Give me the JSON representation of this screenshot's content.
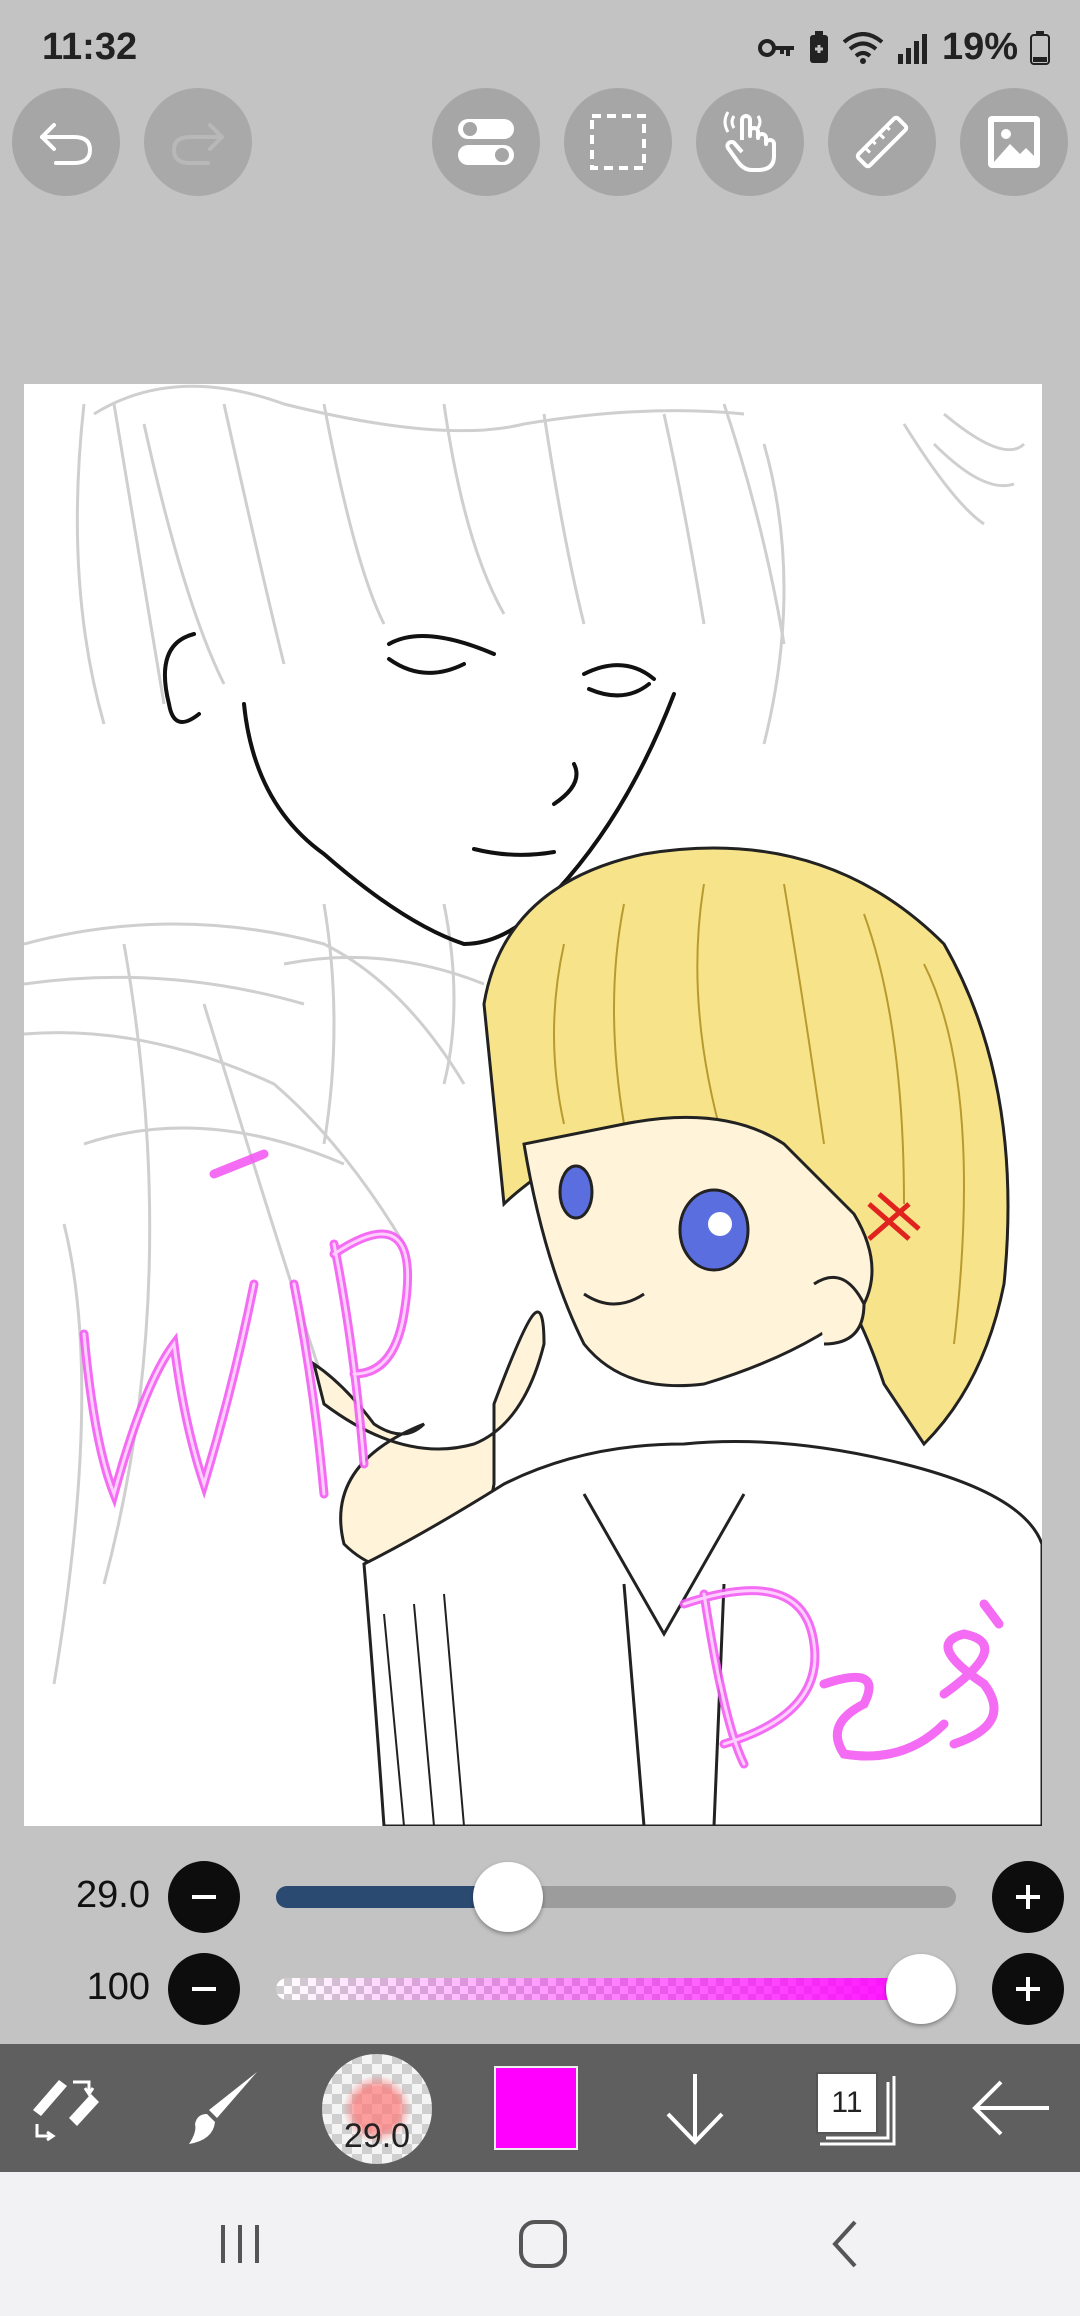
{
  "status": {
    "time": "11:32",
    "battery": "19%",
    "icons": [
      "vpn-key-icon",
      "battery-saver-icon",
      "wifi-icon",
      "signal-icon",
      "battery-icon"
    ]
  },
  "toolbar_top": {
    "icons": [
      "undo-icon",
      "redo-icon",
      "toggle-icon",
      "selection-icon",
      "hand-tool-icon",
      "ruler-icon",
      "image-icon"
    ]
  },
  "sliders": {
    "brush_size": {
      "value": "29.0",
      "fraction": 0.29
    },
    "opacity": {
      "value": "100",
      "fraction": 1.0
    }
  },
  "bottom_toolbar": {
    "brush_size": "29.0",
    "color": "#ff00ff",
    "layer_count": "11",
    "icons": [
      "transform-tool-icon",
      "brush-icon",
      "brush-size-icon",
      "color-swatch",
      "download-icon",
      "layers-icon",
      "back-arrow-icon"
    ]
  },
  "artwork": {
    "labels": [
      "wip",
      "Des"
    ]
  },
  "colors": {
    "brush_track": "#2b4a72",
    "opacity_color": "#ff00ff",
    "toolbar_bg": "#5f5f5f"
  }
}
